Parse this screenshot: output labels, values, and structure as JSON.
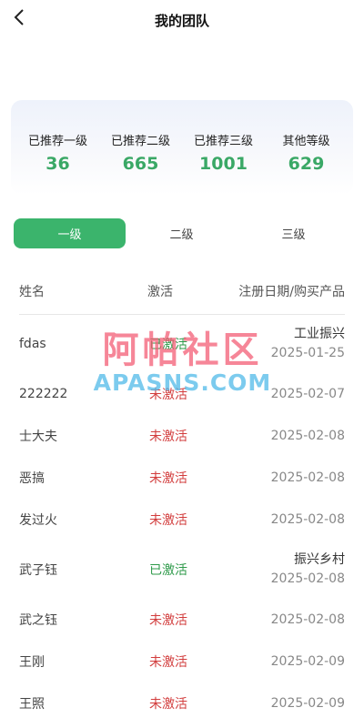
{
  "header": {
    "title": "我的团队"
  },
  "stats": [
    {
      "label": "已推荐一级",
      "value": "36"
    },
    {
      "label": "已推荐二级",
      "value": "665"
    },
    {
      "label": "已推荐三级",
      "value": "1001"
    },
    {
      "label": "其他等级",
      "value": "629"
    }
  ],
  "tabs": [
    {
      "label": "一级",
      "active": true
    },
    {
      "label": "二级",
      "active": false
    },
    {
      "label": "三级",
      "active": false
    }
  ],
  "table": {
    "headers": {
      "name": "姓名",
      "status": "激活",
      "date": "注册日期/购买产品"
    },
    "rows": [
      {
        "name": "fdas",
        "status": "已激活",
        "product": "工业振兴",
        "date": "2025-01-25"
      },
      {
        "name": "222222",
        "status": "未激活",
        "product": "",
        "date": "2025-02-07"
      },
      {
        "name": "士大夫",
        "status": "未激活",
        "product": "",
        "date": "2025-02-08"
      },
      {
        "name": "恶搞",
        "status": "未激活",
        "product": "",
        "date": "2025-02-08"
      },
      {
        "name": "发过火",
        "status": "未激活",
        "product": "",
        "date": "2025-02-08"
      },
      {
        "name": "武子钰",
        "status": "已激活",
        "product": "振兴乡村",
        "date": "2025-02-08"
      },
      {
        "name": "武之钰",
        "status": "未激活",
        "product": "",
        "date": "2025-02-08"
      },
      {
        "name": "王刚",
        "status": "未激活",
        "product": "",
        "date": "2025-02-09"
      },
      {
        "name": "王照",
        "status": "未激活",
        "product": "",
        "date": "2025-02-09"
      }
    ]
  },
  "watermark": {
    "text": "阿帕社区",
    "subtext": "APASNS.COM"
  },
  "colors": {
    "accent": "#3bb46c",
    "active_status": "#2e9a4a",
    "inactive_status": "#d23c3c"
  }
}
